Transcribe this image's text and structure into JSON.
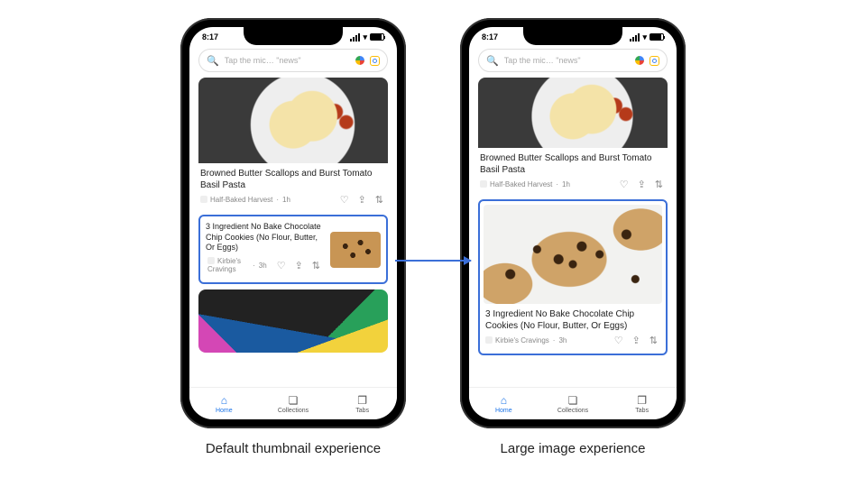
{
  "captions": {
    "left": "Default thumbnail experience",
    "right": "Large image experience"
  },
  "status": {
    "time": "8:17"
  },
  "search": {
    "placeholder": "Tap the mic… \"news\""
  },
  "articles": {
    "pasta": {
      "title": "Browned Butter Scallops and Burst Tomato Basil Pasta",
      "source": "Half-Baked Harvest",
      "age": "1h"
    },
    "cookie": {
      "title": "3 Ingredient No Bake Chocolate Chip Cookies (No Flour, Butter, Or Eggs)",
      "source": "Kirbie's Cravings",
      "age": "3h"
    }
  },
  "nav": {
    "home": "Home",
    "collections": "Collections",
    "tabs": "Tabs"
  },
  "icons": {
    "heart": "♡",
    "share": "⇪",
    "tune": "⇅",
    "home": "⌂",
    "collections": "❏",
    "tabs": "❐",
    "wifi": "▾",
    "search": "🔍"
  }
}
